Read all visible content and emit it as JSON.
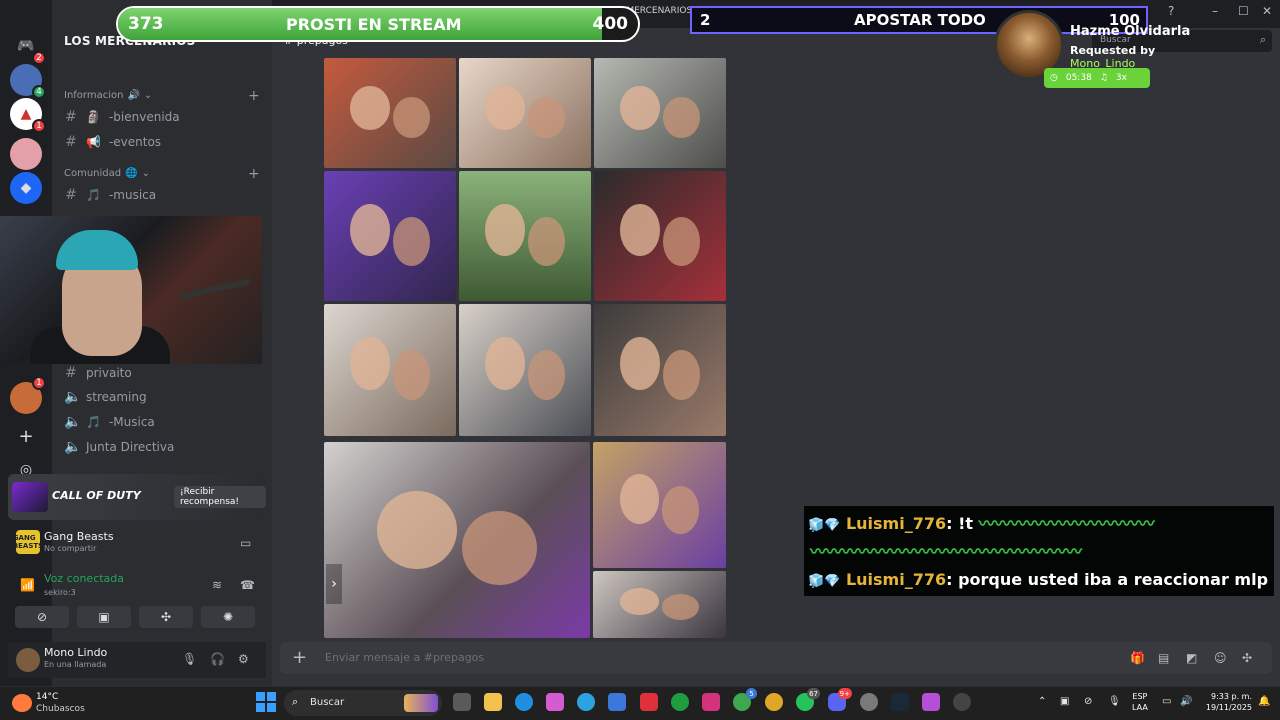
{
  "server": {
    "name": "LOS MERCENARIOS",
    "categories": [
      {
        "label": "Informacion",
        "emoji": "🔊"
      },
      {
        "label": "Comunidad",
        "emoji": "🌐"
      }
    ],
    "channels": [
      {
        "label": "-bienvenida",
        "emoji": "🗿",
        "kind": "text"
      },
      {
        "label": "-eventos",
        "emoji": "📢",
        "kind": "text"
      },
      {
        "label": "-musica",
        "emoji": "🎵",
        "kind": "text"
      },
      {
        "label": "privaito",
        "emoji": "",
        "kind": "text"
      },
      {
        "label": "streaming",
        "emoji": "",
        "kind": "voice"
      },
      {
        "label": "-Musica",
        "emoji": "🎵",
        "kind": "voice"
      },
      {
        "label": "Junta Directiva",
        "emoji": "",
        "kind": "voice"
      }
    ],
    "badges": [
      "2",
      "4",
      "1",
      "1"
    ]
  },
  "promo": {
    "title": "CALL OF DUTY",
    "button": "¡Recibir recompensa!"
  },
  "activity": {
    "game": "Gang Beasts",
    "sub": "No compartir",
    "logo": "GANG BEASTS"
  },
  "voice": {
    "status": "Voz conectada",
    "channel": "sekiro:3"
  },
  "user": {
    "name": "Mono Lindo",
    "status": "En una llamada"
  },
  "chat": {
    "channel": "prepagos",
    "placeholder": "Enviar mensaje a #prepagos",
    "search_placeholder": "Buscar",
    "small_server": "LOS MERCENARIOS"
  },
  "stream": {
    "bar_left": {
      "left": "373",
      "center": "PROSTI EN STREAM",
      "right": "400",
      "progress": 0.93
    },
    "bar_right": {
      "left": "2",
      "center": "APOSTAR TODO",
      "right": "100"
    },
    "song": {
      "title": "Hazme Olvidarla",
      "requested_prefix": "Requested by ",
      "requester": "Mono_Lindo",
      "time": "05:38",
      "plays": "3x"
    },
    "chat": [
      {
        "user": "Luismi_776",
        "text": ": !t"
      },
      {
        "user": "Luismi_776",
        "text": ": porque usted iba a reaccionar mlp"
      }
    ]
  },
  "taskbar": {
    "temp": "14°C",
    "weather": "Chubascos",
    "search": "Buscar",
    "lang1": "ESP",
    "lang2": "LAA",
    "time": "9:33 p. m.",
    "date": "19/11/2025",
    "badges": [
      "5",
      "67",
      "9+"
    ]
  },
  "colors": {
    "accent_green": "#23a55a",
    "bar_green": "#4caf50",
    "bar_purple": "#6d63ff",
    "username": "#e5b53a"
  }
}
